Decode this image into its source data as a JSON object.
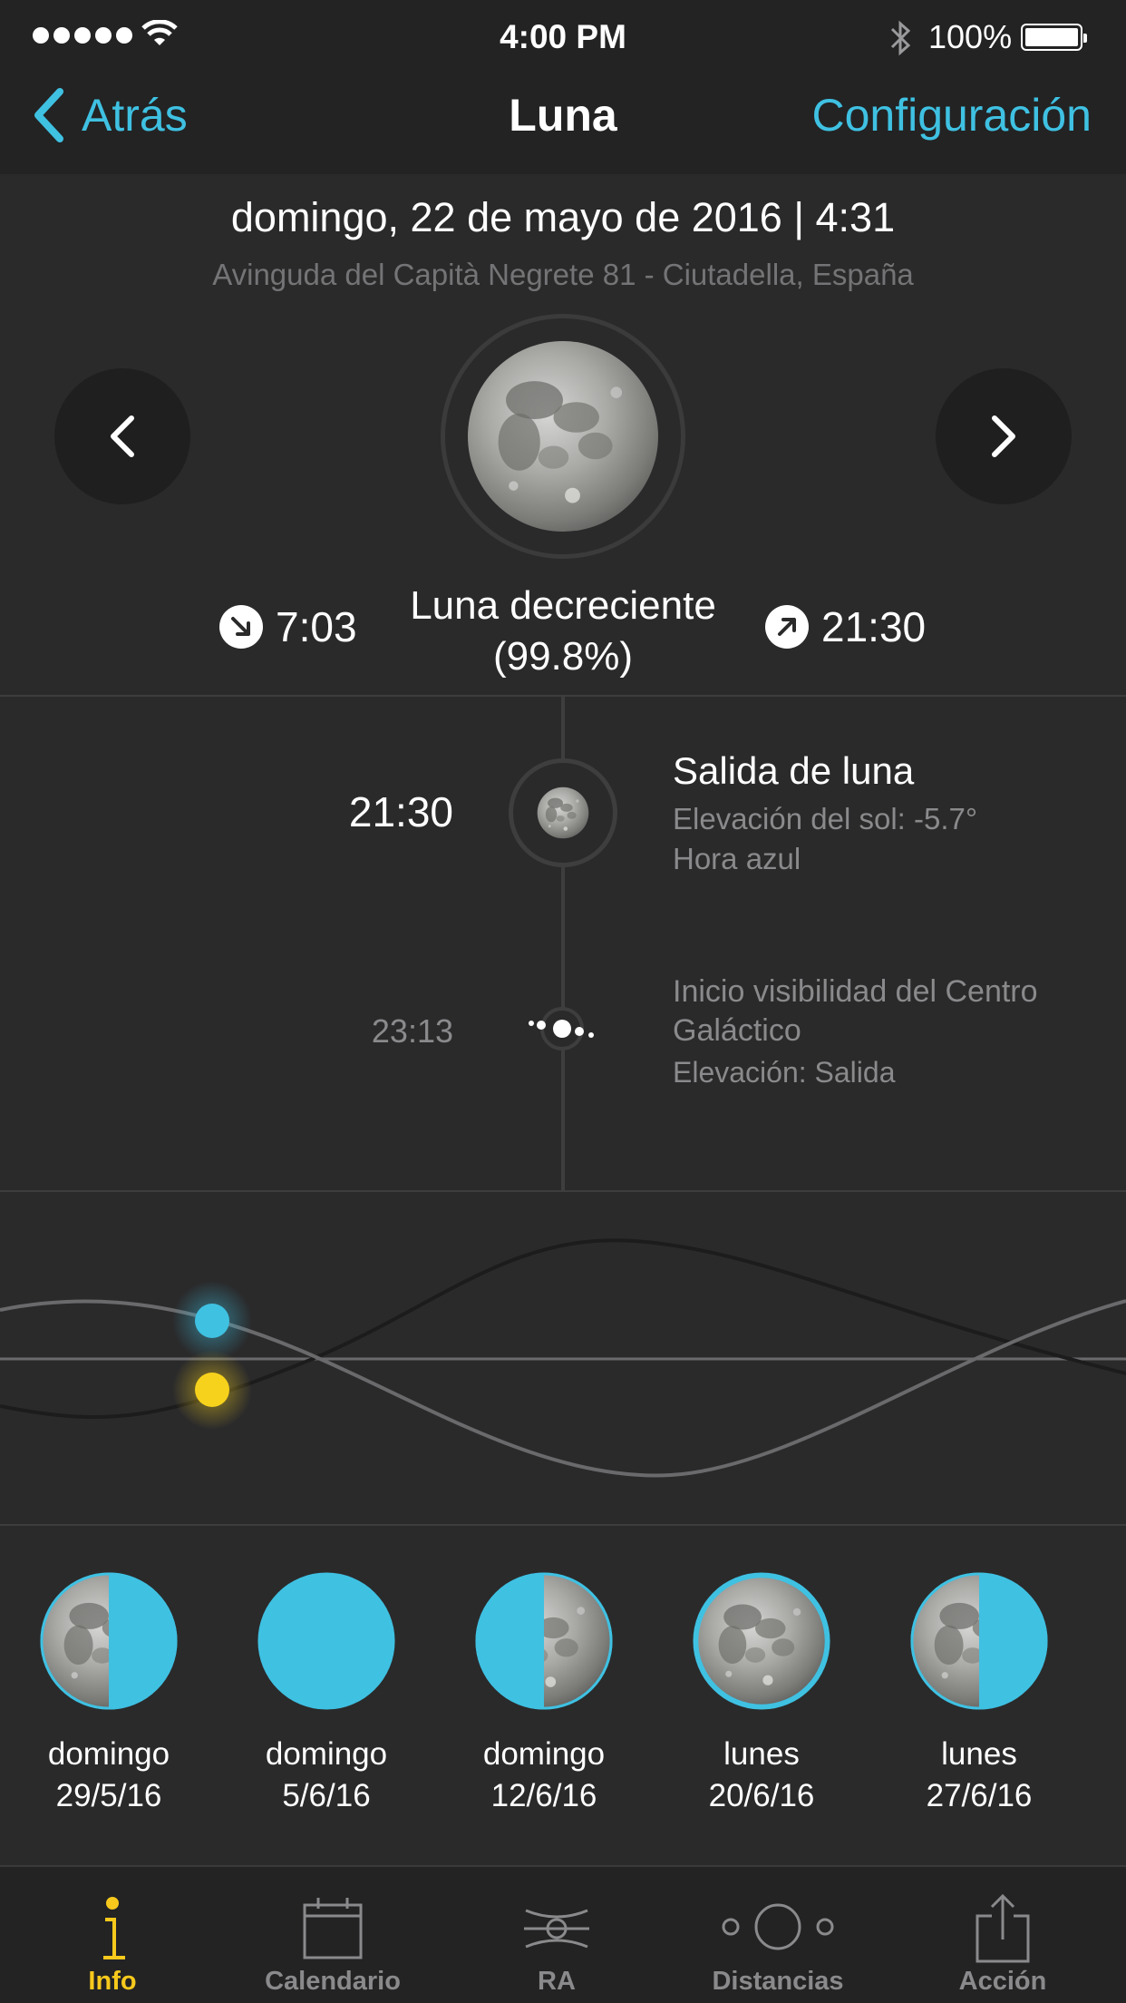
{
  "status_bar": {
    "time": "4:00 PM",
    "battery": "100%"
  },
  "nav": {
    "back_label": "Atrás",
    "title": "Luna",
    "settings_label": "Configuración"
  },
  "header": {
    "date": "domingo, 22 de mayo de 2016 | 4:31",
    "location": "Avinguda del Capità Negrete 81 - Ciutadella, España"
  },
  "moon": {
    "moonset_time": "7:03",
    "moonrise_time": "21:30",
    "phase_name": "Luna decreciente",
    "phase_percent": "(99.8%)",
    "illumination": 0.998
  },
  "events": [
    {
      "time": "21:30",
      "title": "Salida de luna",
      "line1": "Elevación del sol: -5.7°",
      "line2": "Hora azul"
    },
    {
      "time": "23:13",
      "title": "Inicio visibilidad del Centro Galáctico",
      "line1": "Elevación: Salida"
    }
  ],
  "phases": [
    {
      "day": "domingo",
      "date": "29/5/16",
      "type": "last-quarter"
    },
    {
      "day": "domingo",
      "date": "5/6/16",
      "type": "new"
    },
    {
      "day": "domingo",
      "date": "12/6/16",
      "type": "first-quarter"
    },
    {
      "day": "lunes",
      "date": "20/6/16",
      "type": "full"
    },
    {
      "day": "lunes",
      "date": "27/6/16",
      "type": "last-quarter"
    }
  ],
  "tabs": [
    {
      "label": "Info",
      "icon": "info-icon",
      "active": true
    },
    {
      "label": "Calendario",
      "icon": "calendar-icon",
      "active": false
    },
    {
      "label": "RA",
      "icon": "ar-icon",
      "active": false
    },
    {
      "label": "Distancias",
      "icon": "distances-icon",
      "active": false
    },
    {
      "label": "Acción",
      "icon": "share-icon",
      "active": false
    }
  ],
  "colors": {
    "accent": "#3fc1e2",
    "active_tab": "#f7c91c",
    "background": "#2a2a2b",
    "moon_marker": "#3fc1e2",
    "sun_marker": "#f7d21c"
  }
}
